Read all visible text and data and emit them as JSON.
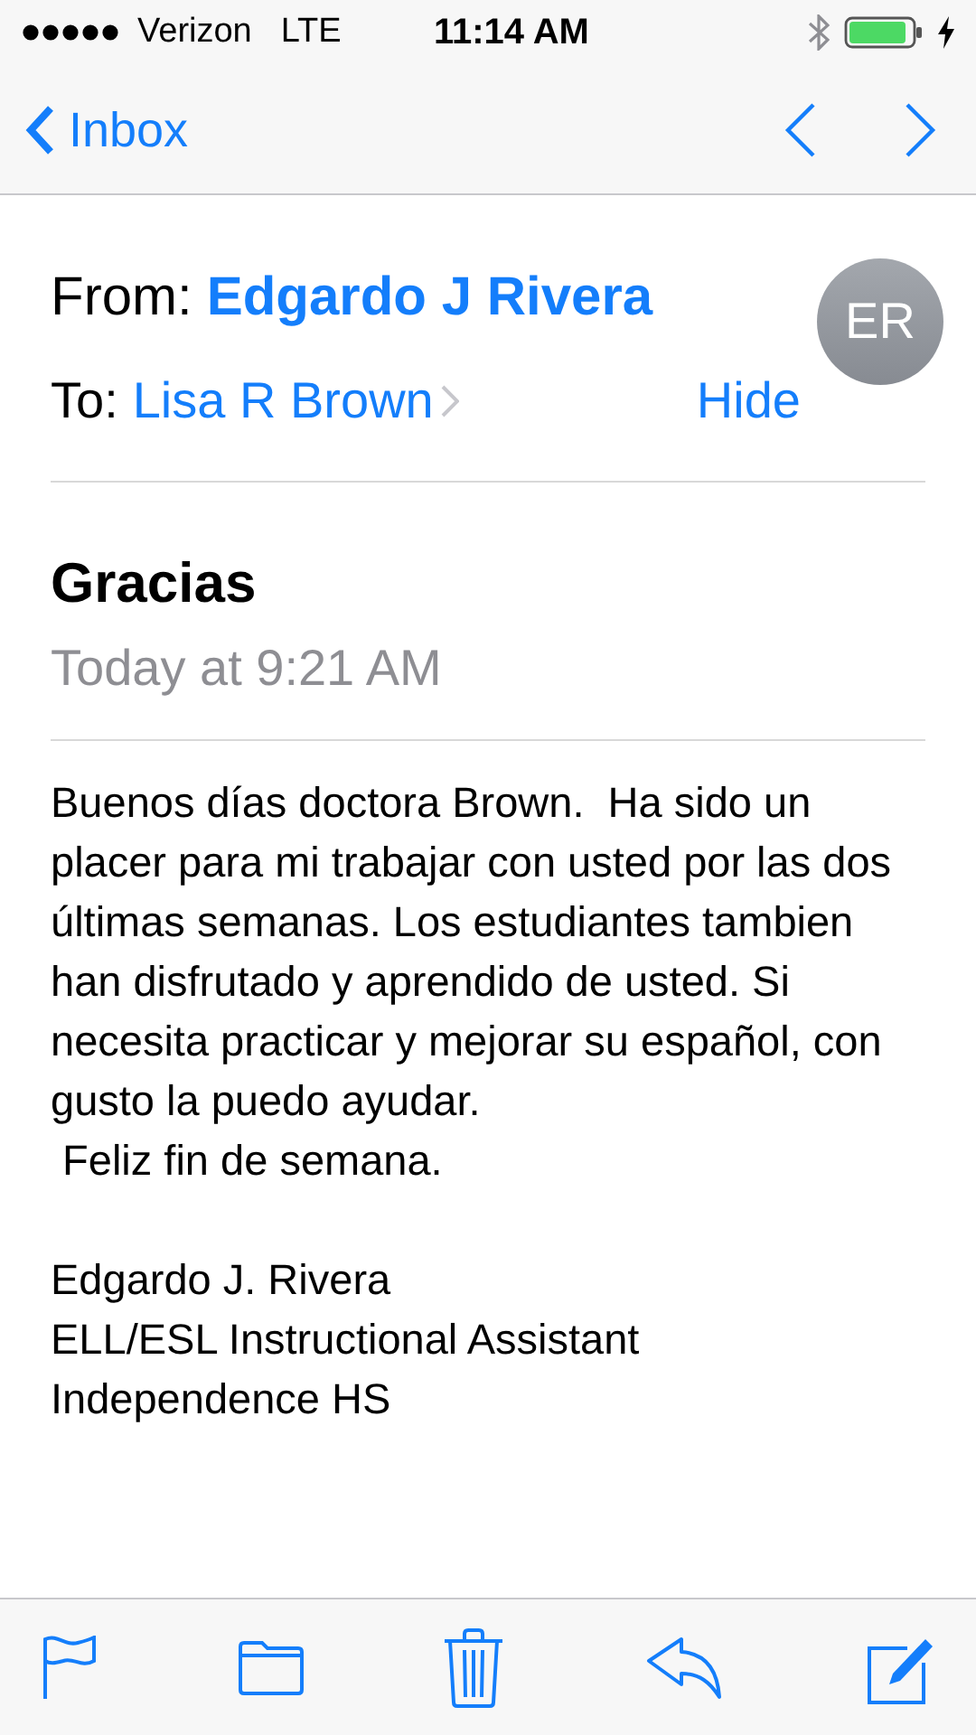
{
  "status_bar": {
    "carrier": "Verizon",
    "network": "LTE",
    "time": "11:14 AM"
  },
  "nav": {
    "back_label": "Inbox"
  },
  "header": {
    "from_label": "From:",
    "from_name": "Edgardo J Rivera",
    "to_label": "To:",
    "to_name": "Lisa R Brown",
    "hide_label": "Hide",
    "avatar_initials": "ER"
  },
  "message": {
    "subject": "Gracias",
    "date": "Today at 9:21 AM",
    "paragraph": "Buenos días doctora Brown.  Ha sido un placer para mi trabajar con usted por las dos últimas semanas. Los estudiantes tambien han disfrutado y aprendido de usted. Si necesita practicar y mejorar su español, con gusto la puedo ayudar.",
    "closing": " Feliz fin de semana.",
    "signature": [
      "Edgardo J. Rivera",
      "ELL/ESL Instructional Assistant",
      "Independence HS"
    ]
  },
  "toolbar": [
    {
      "kind": "flag"
    },
    {
      "kind": "folder"
    },
    {
      "kind": "trash"
    },
    {
      "kind": "reply"
    },
    {
      "kind": "compose"
    }
  ]
}
